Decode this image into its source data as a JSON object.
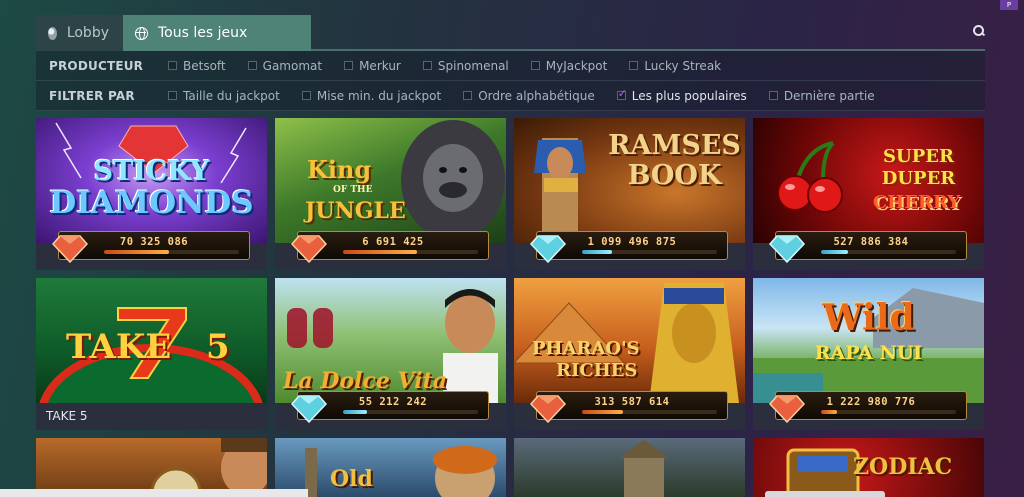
{
  "tabs": [
    {
      "label": "Lobby",
      "icon": "lobby-icon"
    },
    {
      "label": "Tous les jeux",
      "icon": "globe-icon"
    }
  ],
  "filters": {
    "producer_label": "PRODUCTEUR",
    "producers": [
      {
        "label": "Betsoft",
        "checked": false
      },
      {
        "label": "Gamomat",
        "checked": false
      },
      {
        "label": "Merkur",
        "checked": false
      },
      {
        "label": "Spinomenal",
        "checked": false
      },
      {
        "label": "MyJackpot",
        "checked": false
      },
      {
        "label": "Lucky Streak",
        "checked": false
      }
    ],
    "sort_label": "FILTRER PAR",
    "sorts": [
      {
        "label": "Taille du jackpot",
        "checked": false
      },
      {
        "label": "Mise min. du jackpot",
        "checked": false
      },
      {
        "label": "Ordre alphabétique",
        "checked": false
      },
      {
        "label": "Les plus populaires",
        "checked": true
      },
      {
        "label": "Dernière partie",
        "checked": false
      }
    ]
  },
  "games": [
    {
      "art": {
        "line1": "STICKY",
        "line2": "DIAMONDS"
      },
      "jackpot": "70 325 086",
      "gem": "red",
      "progress": 0.48
    },
    {
      "art": {
        "line1": "King",
        "line2": "OF THE",
        "line3": "JUNGLE"
      },
      "jackpot": "6 691 425",
      "gem": "red",
      "progress": 0.55
    },
    {
      "art": {
        "line1": "RAMSES",
        "line2": "BOOK"
      },
      "jackpot": "1 099 496 875",
      "gem": "blue",
      "progress": 0.22
    },
    {
      "art": {
        "line1": "SUPER",
        "line2": "DUPER",
        "line3": "CHERRY"
      },
      "jackpot": "527 886 384",
      "gem": "blue",
      "progress": 0.2
    },
    {
      "art": {
        "line1": "TAKE",
        "line2": "5"
      },
      "name": "TAKE 5"
    },
    {
      "art": {
        "line1": "La Dolce Vita"
      },
      "jackpot": "55 212 242",
      "gem": "blue",
      "progress": 0.18
    },
    {
      "art": {
        "line1": "PHARAO'S",
        "line2": "RICHES"
      },
      "jackpot": "313 587 614",
      "gem": "red",
      "progress": 0.3
    },
    {
      "art": {
        "line1": "Wild",
        "line2": "RAPA NUI"
      },
      "jackpot": "1 222 980 776",
      "gem": "red",
      "progress": 0.12
    }
  ],
  "partial_row": [
    {
      "art": {
        "line1": ""
      }
    },
    {
      "art": {
        "line1": "Old"
      }
    },
    {
      "art": {
        "line1": ""
      }
    },
    {
      "art": {
        "line1": "ZODIAC"
      }
    }
  ],
  "colors": {
    "accent": "#4f8377",
    "checkbox_on": "#b066e8",
    "jackpot_text": "#ffd18b"
  }
}
